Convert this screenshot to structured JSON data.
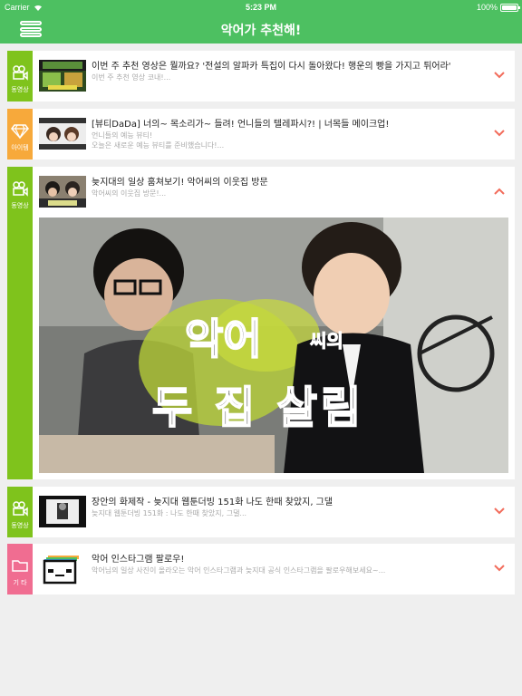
{
  "status_bar": {
    "carrier": "Carrier",
    "time": "5:23 PM",
    "battery": "100%"
  },
  "nav": {
    "title": "악어가 추천해!"
  },
  "colors": {
    "accent": "#4dc061",
    "video_tag": "#7fc31c",
    "item_tag": "#f7a93b",
    "other_tag": "#f06d91",
    "chevron": "#f26c5b"
  },
  "cards": [
    {
      "tag_label": "동영상",
      "tag_icon": "video-camera-icon",
      "title": "이번 주 추천 영상은 뭘까요? '전설의 알파카 특집이 다시 돌아왔다! 행운의 빵을 가지고 튀어라'",
      "sub": [
        "이번 주 추천 영상 코내!..."
      ],
      "expanded": false
    },
    {
      "tag_label": "아이템",
      "tag_icon": "diamond-icon",
      "title": "[뷰티DaDa] 너의~ 목소리가~ 들려! 언니들의 텔레파시?! | 너목들 메이크업!",
      "sub": [
        "언니들의 예능 뷰티!",
        "오늘은 새로운 예능 뷰티를 준비했습니다!..."
      ],
      "expanded": false
    },
    {
      "tag_label": "동영상",
      "tag_icon": "video-camera-icon",
      "title": "늦지대의 일상 훔쳐보기! 악어씨의 이웃집 방문",
      "sub": [
        "악어씨의 이웃집 방문!..."
      ],
      "expanded": true,
      "image_caption": [
        "악어",
        "씨의",
        "두 집 살림"
      ]
    },
    {
      "tag_label": "동영상",
      "tag_icon": "video-camera-icon",
      "title": "장안의 화제작 - 늦지대 웹툰더빙 151화 나도 한때 찾았지, 그댈",
      "sub": [
        "늦지대 웹툰더빙 151화 : 나도 한때 찾았지, 그댈..."
      ],
      "expanded": false
    },
    {
      "tag_label": "기 타",
      "tag_icon": "folder-icon",
      "title": "악어 인스타그램 팔로우!",
      "sub": [
        "악어님의 일상 사진이 올라오는 악어 인스타그램과 늦지대 공식 인스타그램을 팔로우해보세요~..."
      ],
      "expanded": false
    }
  ]
}
